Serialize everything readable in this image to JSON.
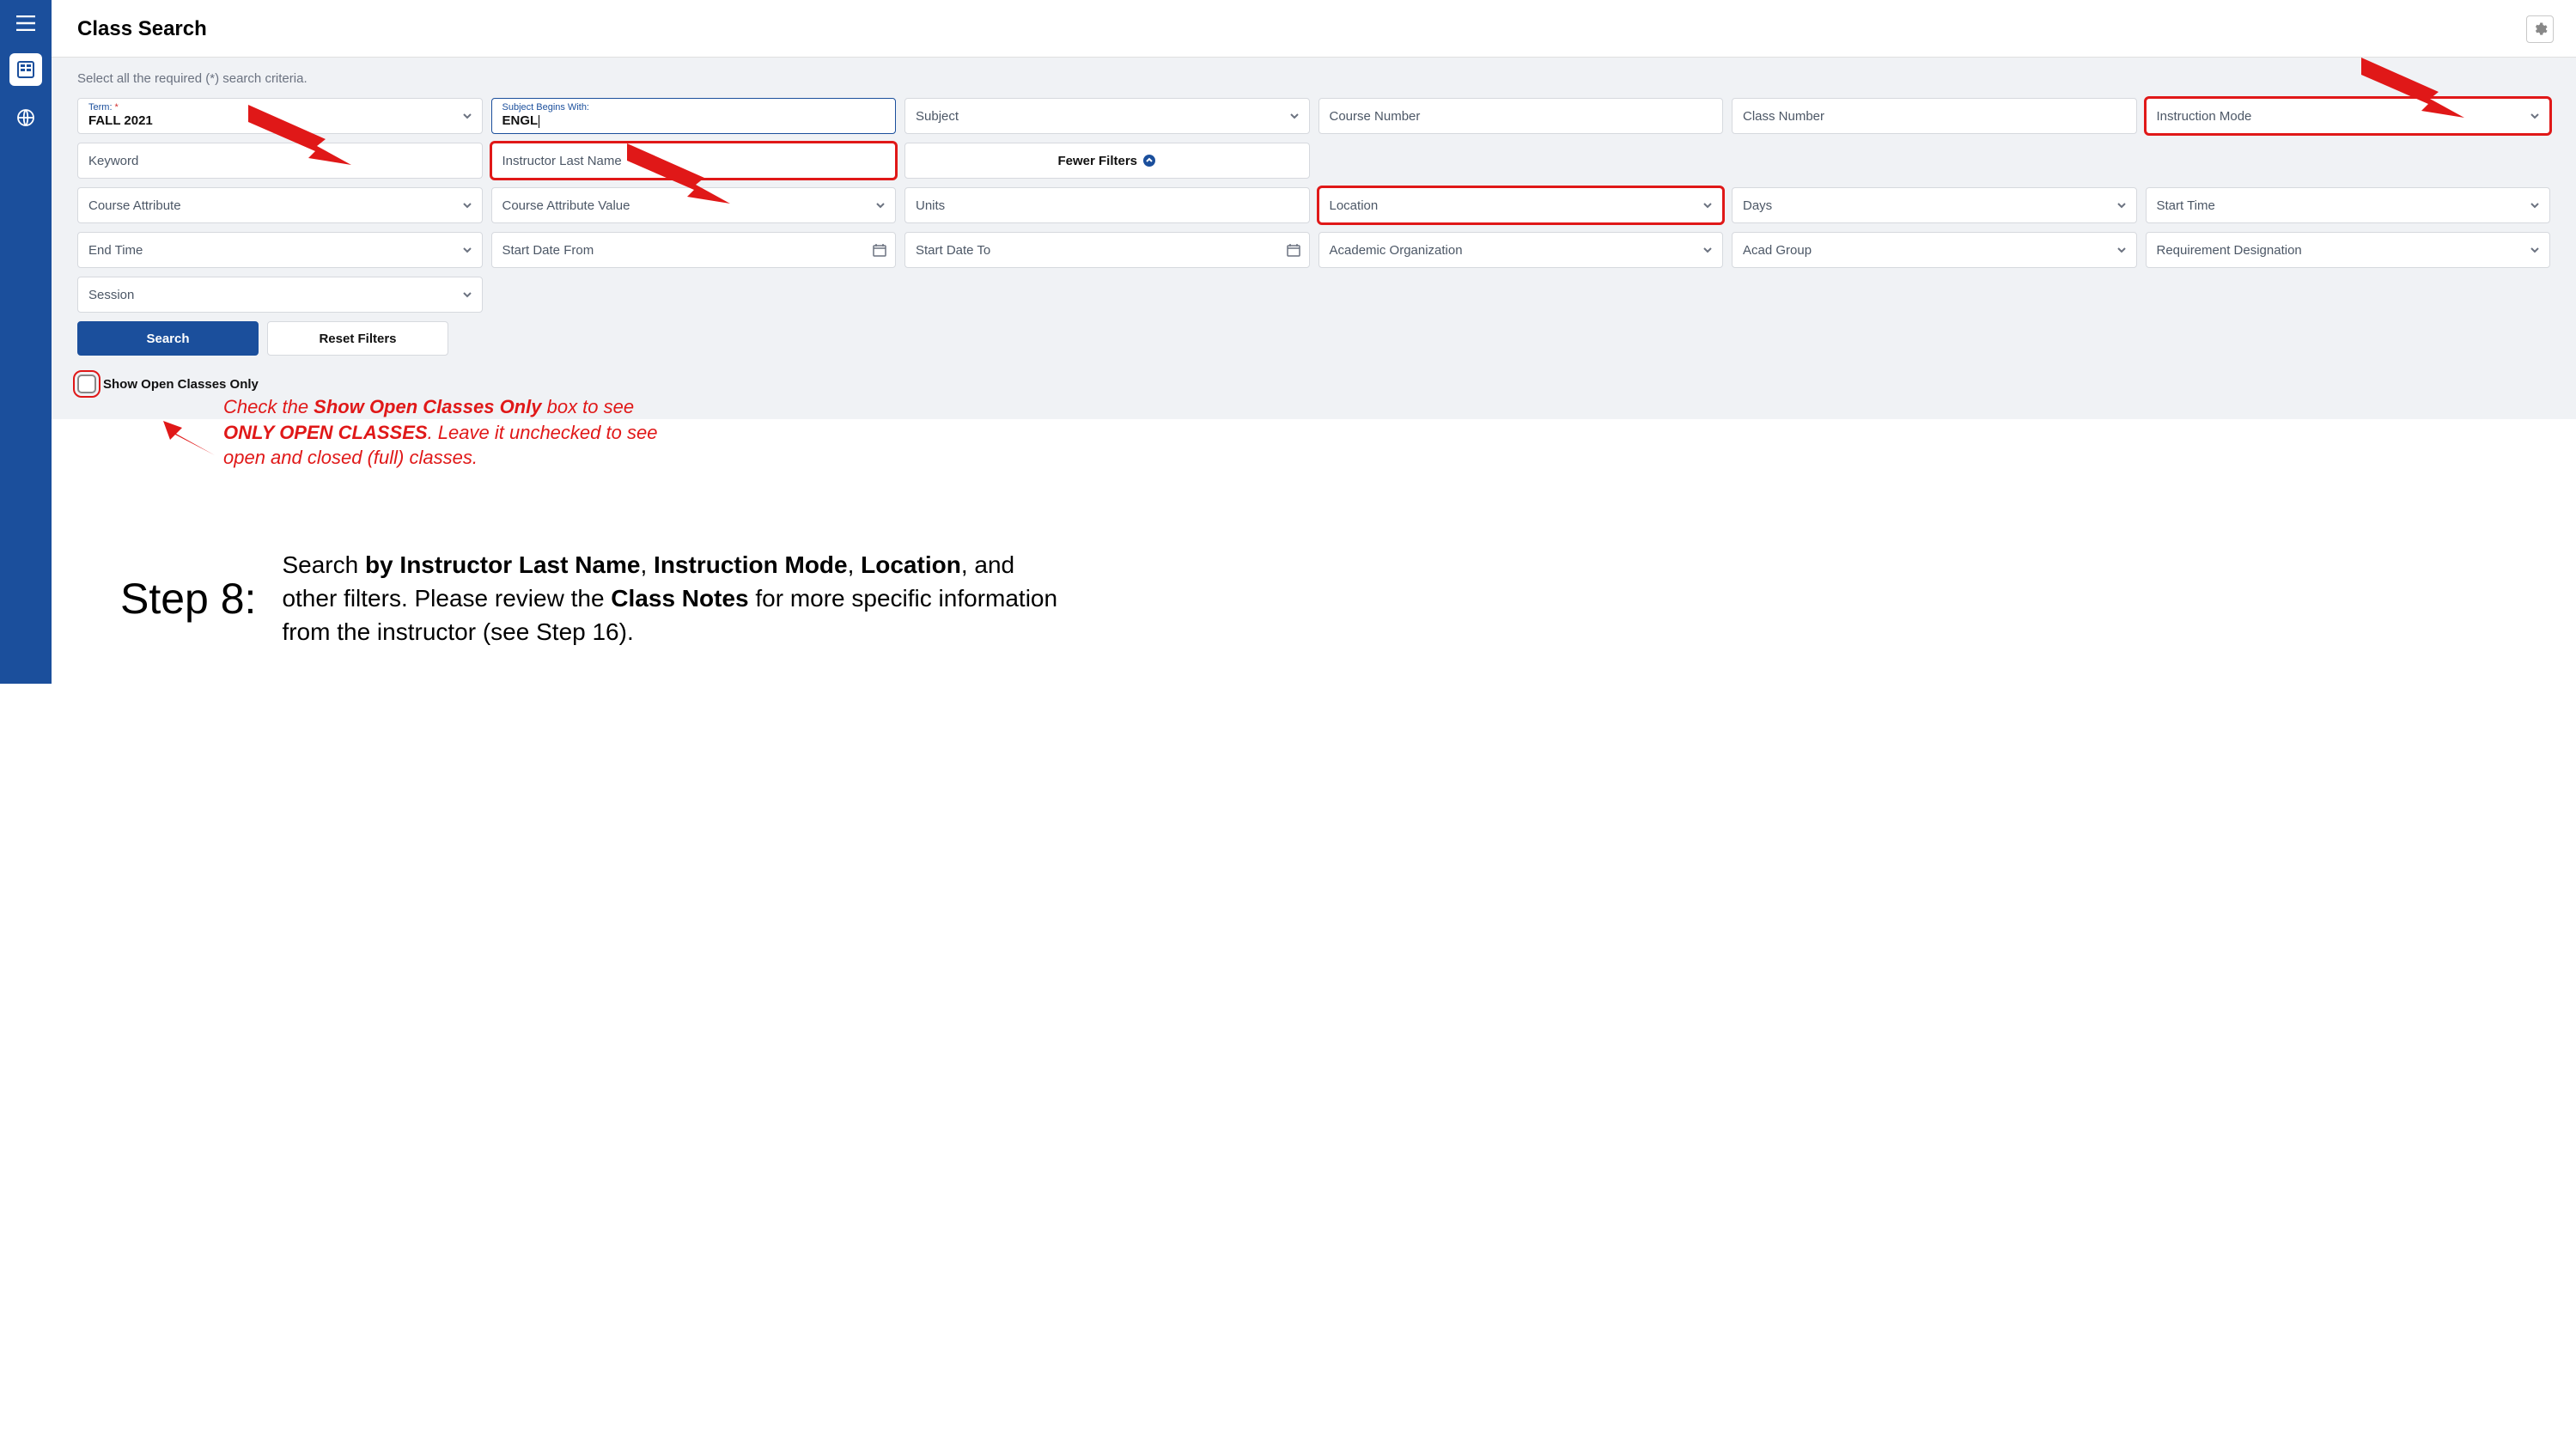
{
  "header": {
    "title": "Class Search"
  },
  "criteria_label": "Select all the required (*) search criteria.",
  "fields": {
    "term": {
      "label": "Term:",
      "value": "FALL 2021"
    },
    "subject_begins": {
      "label": "Subject Begins With:",
      "value": "ENGL"
    },
    "subject": "Subject",
    "course_number": "Course Number",
    "class_number": "Class Number",
    "instruction_mode": "Instruction Mode",
    "keyword": "Keyword",
    "instructor_last_name": "Instructor Last Name",
    "fewer_filters": "Fewer Filters",
    "course_attribute": "Course Attribute",
    "course_attribute_value": "Course Attribute Value",
    "units": "Units",
    "location": "Location",
    "days": "Days",
    "start_time": "Start Time",
    "end_time": "End Time",
    "start_date_from": "Start Date From",
    "start_date_to": "Start Date To",
    "academic_org": "Academic Organization",
    "acad_group": "Acad Group",
    "req_designation": "Requirement Designation",
    "session": "Session"
  },
  "buttons": {
    "search": "Search",
    "reset": "Reset Filters"
  },
  "open_only": "Show Open Classes Only",
  "annotation": {
    "pre": "Check the ",
    "bold1": "Show Open Classes Only",
    "mid1": " box to see ",
    "bold2": "ONLY OPEN CLASSES",
    "post": ". Leave it unchecked to see open and closed (full) classes."
  },
  "step": {
    "label": "Step 8:",
    "t1": "Search ",
    "b1": "by Instructor Last Name",
    "t2": ", ",
    "b2": "Instruction Mode",
    "t3": ", ",
    "b3": "Location",
    "t4": ", and other filters. Please review the ",
    "b4": "Class Notes",
    "t5": " for more specific information from the instructor (see Step 16)."
  }
}
